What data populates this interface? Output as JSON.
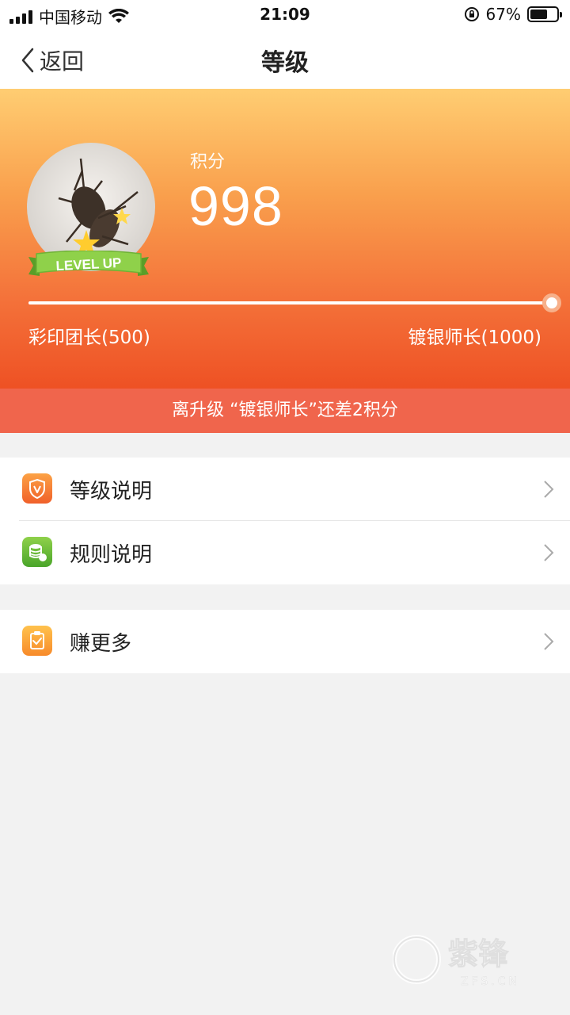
{
  "status_bar": {
    "carrier": "中国移动",
    "time": "21:09",
    "battery": "67%",
    "battery_level": 0.67
  },
  "nav": {
    "back_label": "返回",
    "title": "等级"
  },
  "hero": {
    "badge_text": "LEVEL UP",
    "score_label": "积分",
    "score": "998",
    "current_level": "彩印团长(500)",
    "next_level": "镀银师长(1000)",
    "progress": 0.996
  },
  "notice": "离升级 “镀银师长”还差2积分",
  "menu": {
    "level_desc": "等级说明",
    "rule_desc": "规则说明",
    "earn_more": "赚更多"
  },
  "watermark": {
    "text": "紫锋",
    "sub": "ZFS.CN"
  },
  "colors": {
    "hero_top": "#ffcd72",
    "hero_bottom": "#ee5124",
    "notice_bg": "#f0654c"
  }
}
